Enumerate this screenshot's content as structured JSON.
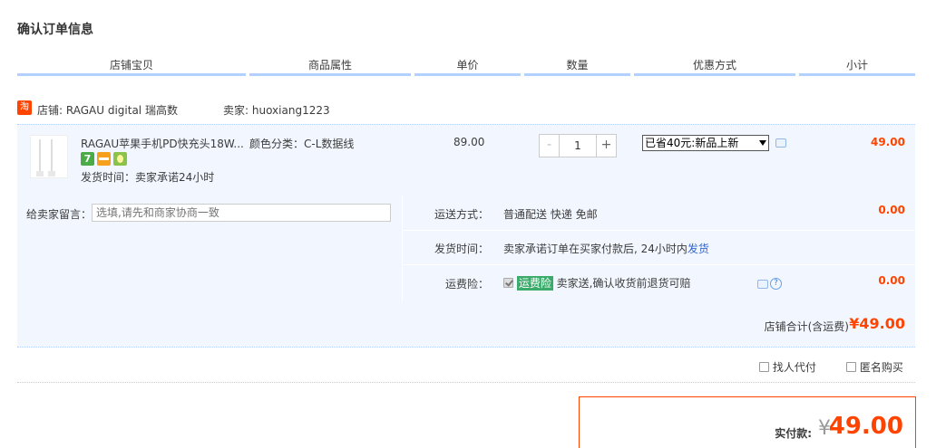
{
  "page": {
    "title": "确认订单信息"
  },
  "columns": [
    "店铺宝贝",
    "商品属性",
    "单价",
    "数量",
    "优惠方式",
    "小计"
  ],
  "shop": {
    "icon_text": "淘",
    "name_prefix": "店铺:",
    "name": "RAGAU digital 瑞高数",
    "seller_prefix": "卖家:",
    "seller": "huoxiang1223"
  },
  "item": {
    "thumb_icon": "product-cable-icon",
    "name": "RAGAU苹果手机PD快充头18W...",
    "service_icons": [
      "seven-day-return-icon",
      "credit-card-icon",
      "green-badge-icon"
    ],
    "service_7": "7",
    "ship_time": "发货时间：卖家承诺24小时",
    "attr": "颜色分类：C-L数据线",
    "price": "89.00",
    "qty": "1",
    "minus": "-",
    "plus": "+",
    "promo": "已省40元:新品上新",
    "subtotal": "49.00"
  },
  "message": {
    "label": "给卖家留言：",
    "placeholder": "选填,请先和商家协商一致"
  },
  "delivery": {
    "method_label": "运送方式：",
    "method_value": "普通配送 快递 免邮",
    "method_fee": "0.00",
    "ship_label": "发货时间：",
    "ship_value": "卖家承诺订单在买家付款后, 24小时内",
    "ship_link": "发货",
    "insurance_label": "运费险：",
    "insurance_tag": "运费险",
    "insurance_value": "卖家送,确认收货前退货可赔",
    "insurance_fee": "0.00",
    "help_glyph": "?"
  },
  "shop_total": {
    "label": "店铺合计(含运费)",
    "value": "¥49.00"
  },
  "options": {
    "proxy_pay": "找人代付",
    "anonymous": "匿名购买"
  },
  "payment": {
    "label": "实付款:",
    "yen": "¥",
    "amount": "49.00"
  },
  "colors": {
    "accent": "#ff4400",
    "header_line": "#b2d1ff",
    "row_bg": "#f2f7ff",
    "link": "#3366cc",
    "insurance_tag": "#3aab6b"
  }
}
